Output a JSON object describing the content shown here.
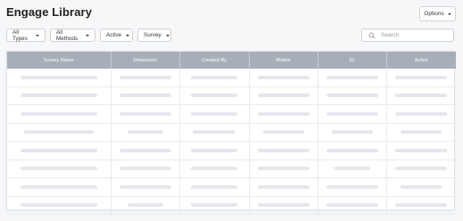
{
  "page": {
    "title": "Engage Library"
  },
  "header": {
    "options_label": "Options"
  },
  "filters": [
    {
      "label": "All Types"
    },
    {
      "label": "All Methods"
    },
    {
      "label": "Active"
    },
    {
      "label": "Survey"
    }
  ],
  "search": {
    "placeholder": "Search",
    "value": ""
  },
  "table": {
    "columns": [
      "Survey Name",
      "Dimension",
      "Created By",
      "Mobile",
      "ID",
      "Active"
    ],
    "rows_loading": 8
  },
  "colors": {
    "header_bg": "#a7aeb8",
    "skeleton": "#e4e7ec",
    "page_bg": "#f5f7f9"
  }
}
